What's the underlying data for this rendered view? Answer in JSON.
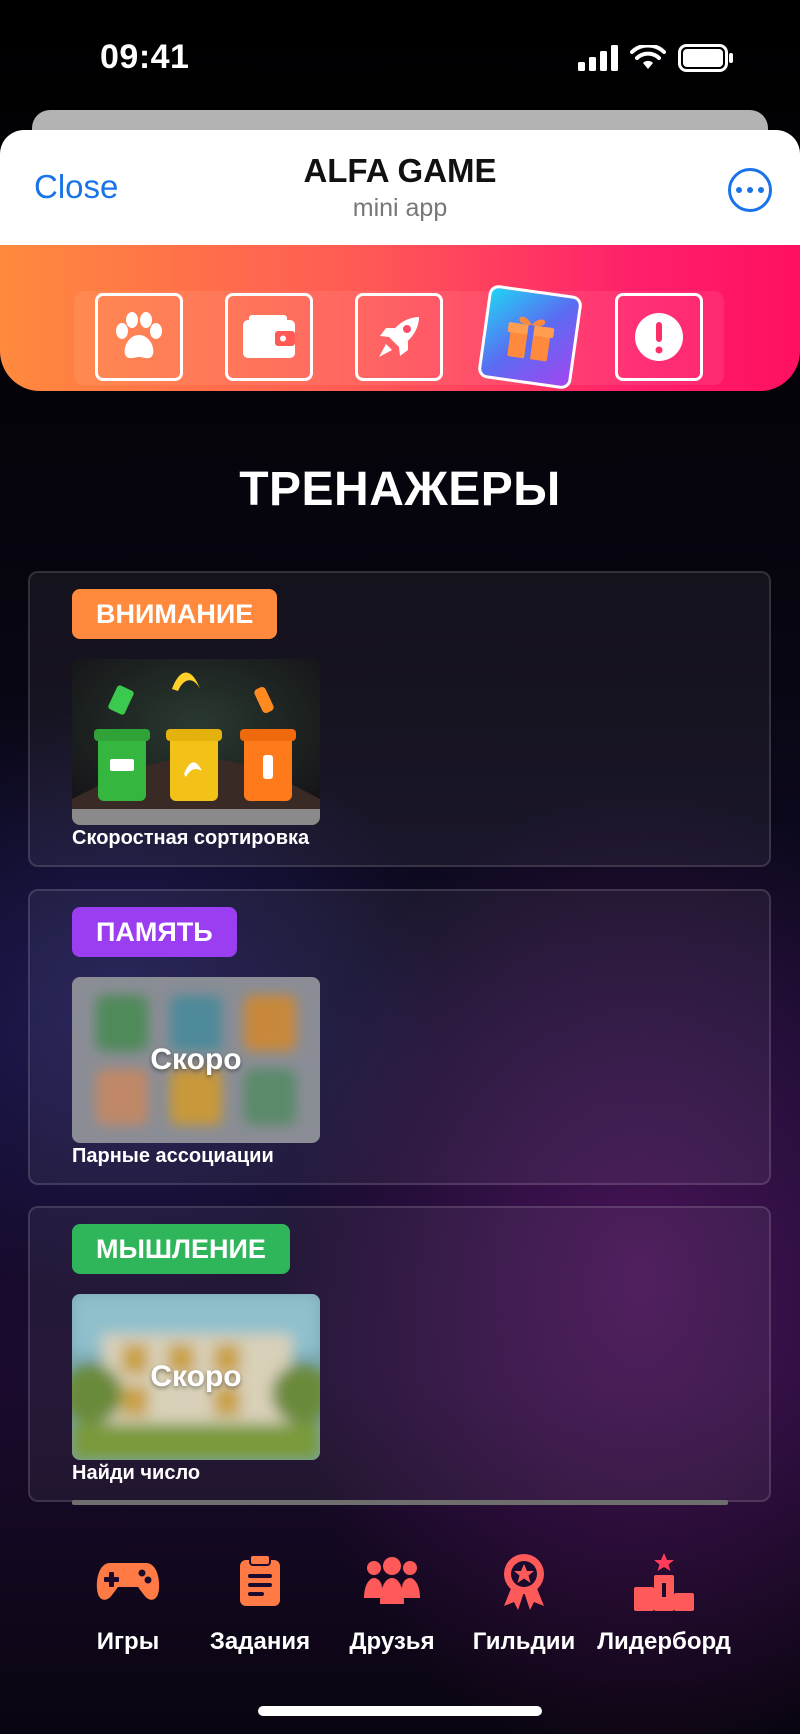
{
  "status_bar": {
    "time": "09:41"
  },
  "sheet": {
    "close_label": "Close",
    "title": "ALFA GAME",
    "subtitle": "mini app"
  },
  "top_nav": {
    "items": [
      {
        "icon": "paw-icon"
      },
      {
        "icon": "wallet-icon"
      },
      {
        "icon": "rocket-icon"
      },
      {
        "icon": "gift-icon",
        "active": true
      },
      {
        "icon": "alert-icon"
      }
    ]
  },
  "section": {
    "title": "ТРЕНАЖЕРЫ"
  },
  "cards": [
    {
      "badge": "ВНИМАНИЕ",
      "badge_color": "#ff8a3d",
      "game": "Скоростная сортировка",
      "soon": ""
    },
    {
      "badge": "ПАМЯТЬ",
      "badge_color": "#9b3df0",
      "game": "Парные ассоциации",
      "soon": "Скоро"
    },
    {
      "badge": "МЫШЛЕНИЕ",
      "badge_color": "#2fb55a",
      "game": "Найди число",
      "soon": "Скоро"
    }
  ],
  "bottom_nav": [
    {
      "label": "Игры",
      "icon": "gamepad-icon"
    },
    {
      "label": "Задания",
      "icon": "clipboard-icon"
    },
    {
      "label": "Друзья",
      "icon": "friends-icon"
    },
    {
      "label": "Гильдии",
      "icon": "guild-badge-icon"
    },
    {
      "label": "Лидерборд",
      "icon": "podium-icon"
    }
  ],
  "colors": {
    "accent": "#ff8a3d",
    "brand_blue": "#1a73e8",
    "nav_icon": "#ff7a45"
  }
}
